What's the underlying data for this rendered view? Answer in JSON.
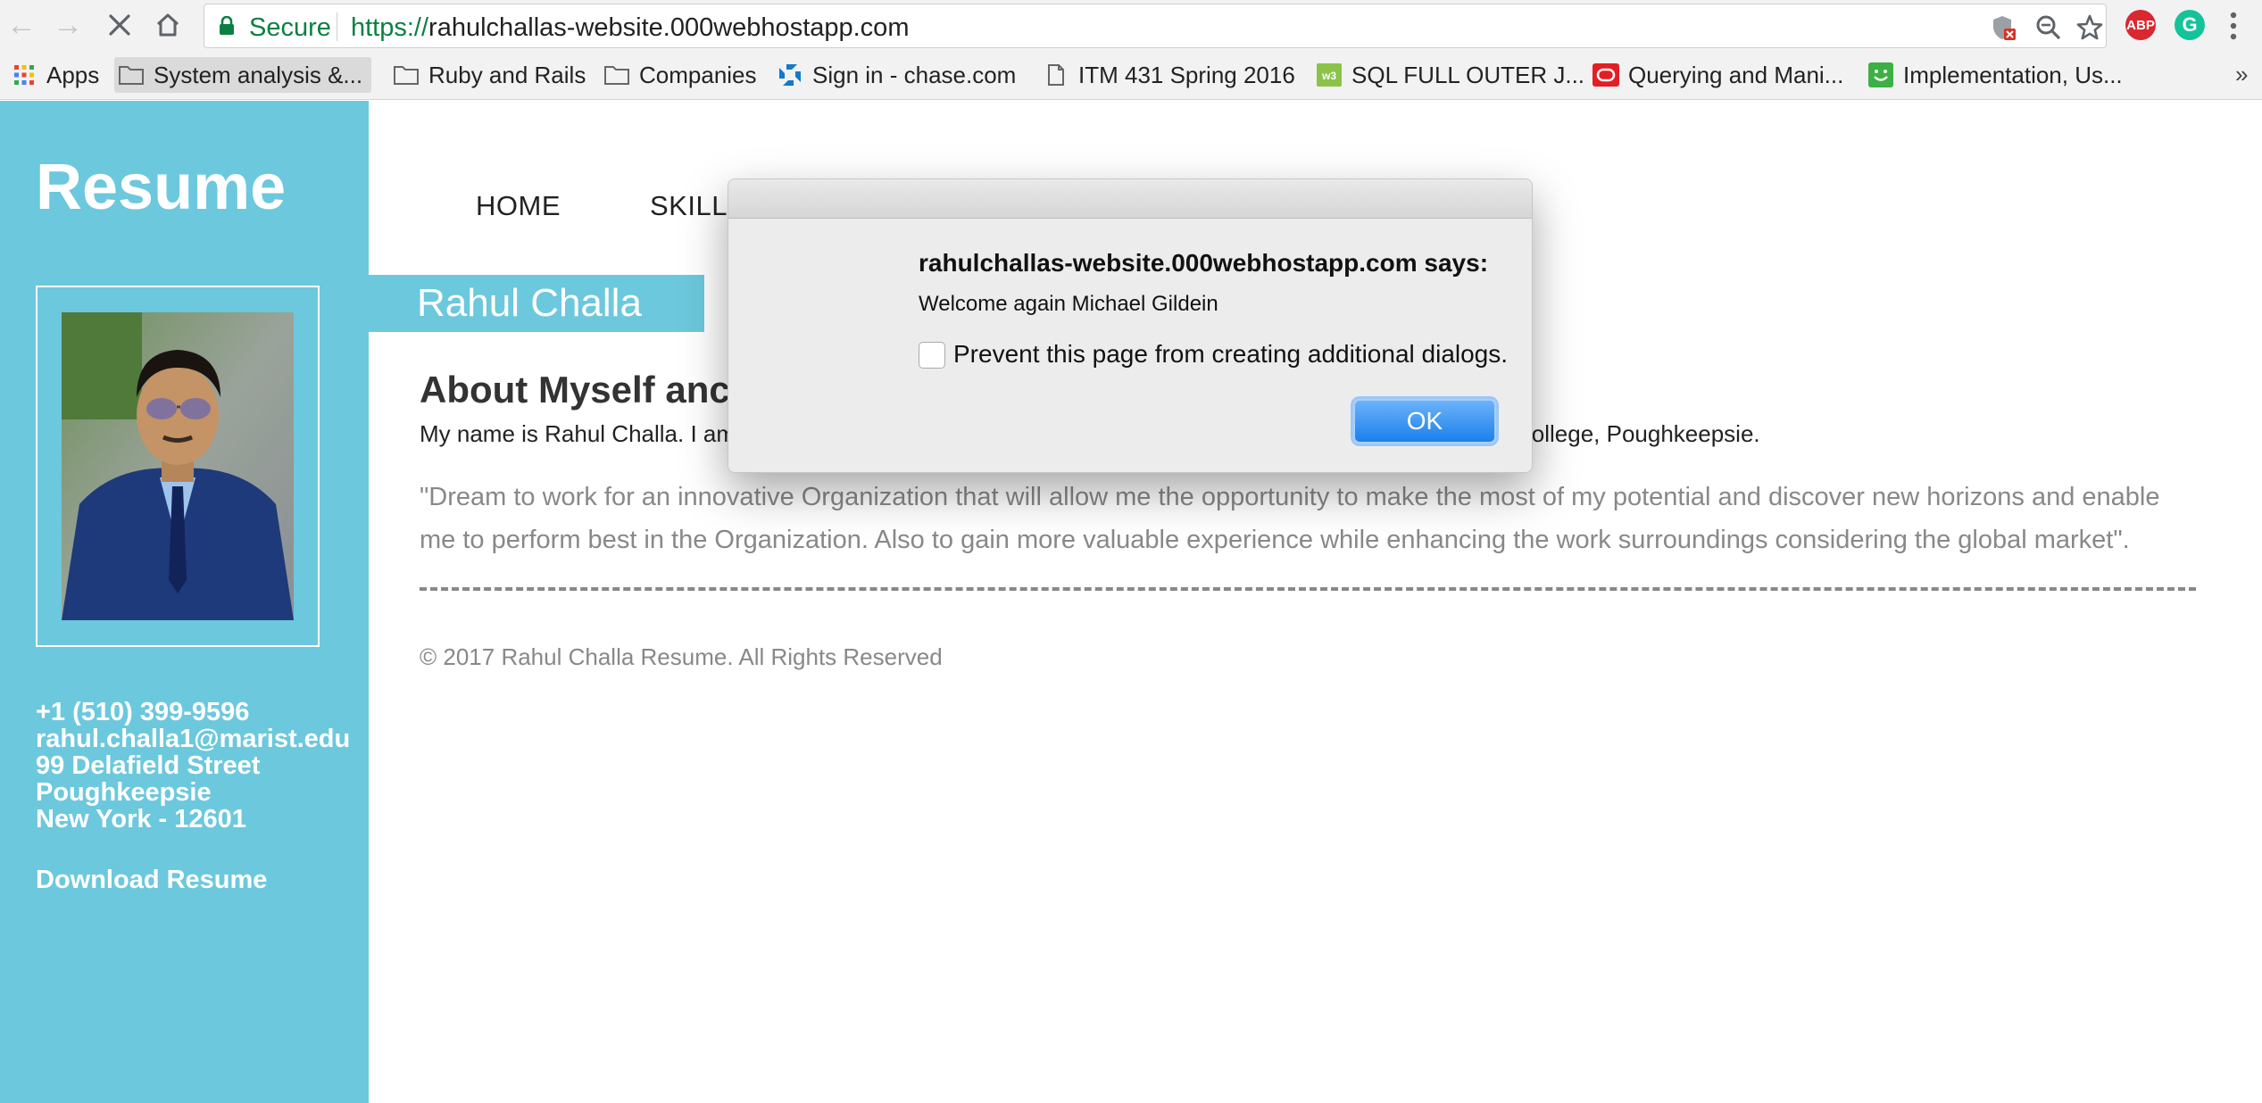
{
  "browser": {
    "secure_label": "Secure",
    "url_scheme": "https://",
    "url_host": "rahulchallas-website.000webhostapp.com",
    "extensions": {
      "adblock_label": "ABP",
      "grammarly_label": "G"
    },
    "bookmarks": [
      {
        "label": "Apps",
        "icon": "apps-grid-icon"
      },
      {
        "label": "System analysis &...",
        "icon": "folder-icon"
      },
      {
        "label": "Ruby and Rails",
        "icon": "folder-icon"
      },
      {
        "label": "Companies",
        "icon": "folder-icon"
      },
      {
        "label": "Sign in - chase.com",
        "icon": "chase-icon"
      },
      {
        "label": "ITM 431 Spring 2016",
        "icon": "page-icon"
      },
      {
        "label": "SQL FULL OUTER J...",
        "icon": "w3schools-icon"
      },
      {
        "label": "Querying and Mani...",
        "icon": "oracle-icon"
      },
      {
        "label": "Implementation, Us...",
        "icon": "smiley-icon"
      }
    ],
    "overflow_label": "»"
  },
  "sidebar": {
    "logo": "Resume",
    "phone": "+1 (510) 399-9596",
    "email": "rahul.challa1@marist.edu",
    "street": "99 Delafield Street",
    "city": "Poughkeepsie",
    "state_zip": "New York - 12601",
    "download_label": "Download Resume"
  },
  "nav": {
    "home": "HOME",
    "skills": "SKILL S"
  },
  "content": {
    "name": "Rahul Challa",
    "heading": "About Myself anc",
    "intro_left": "My name is Rahul Challa. I am",
    "intro_right": "College, Poughkeepsie.",
    "quote": "\"Dream to work for an innovative Organization that will allow me the opportunity to make the most of my potential and discover new horizons and enable me to perform best in the Organization. Also to gain more valuable experience while enhancing the work surroundings considering the global market\".",
    "copyright": "© 2017 Rahul Challa Resume. All Rights Reserved"
  },
  "dialog": {
    "origin": "rahulchallas-website.000webhostapp.com says:",
    "message": "Welcome again Michael Gildein",
    "checkbox_label": "Prevent this page from creating additional dialogs.",
    "checkbox_checked": false,
    "ok_label": "OK"
  },
  "colors": {
    "sidebar": "#6cc8dd",
    "secure_green": "#0b8043",
    "ok_button": "#1c7fec",
    "adblock_red": "#d9282f",
    "grammarly_green": "#15c39a"
  }
}
